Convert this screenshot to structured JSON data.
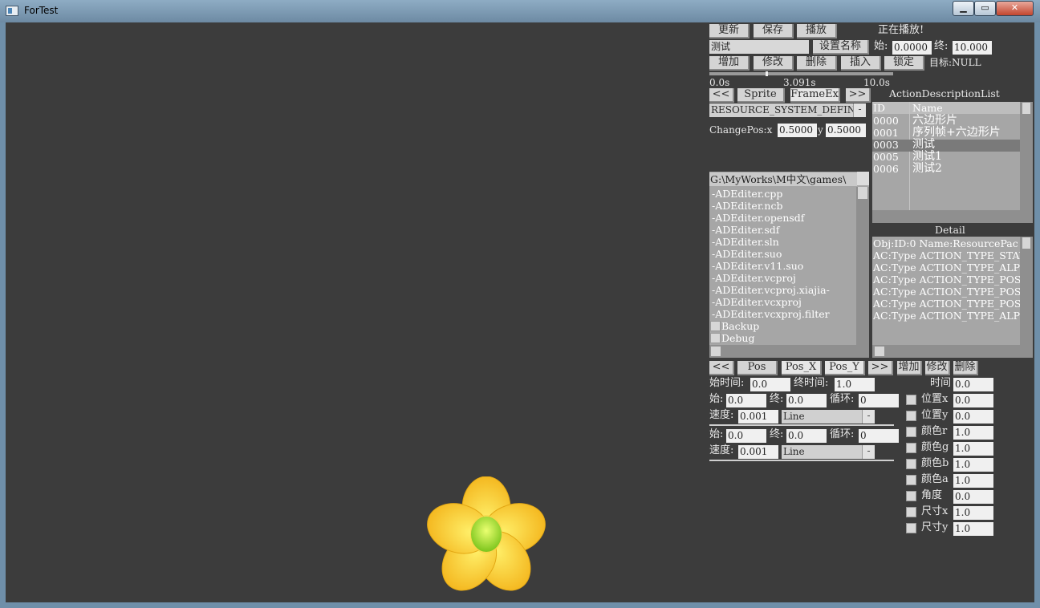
{
  "window": {
    "title": "ForTest",
    "min": "▁",
    "max": "▭",
    "close": "✕"
  },
  "toolbar": {
    "update": "更新",
    "save": "保存",
    "play": "播放",
    "status": "正在播放!",
    "name_value": "测试",
    "set_name": "设置名称",
    "start_label": "始:",
    "start_value": "0.0000",
    "end_label": "终:",
    "end_value": "10.000",
    "add": "增加",
    "modify": "修改",
    "delete": "删除",
    "insert": "插入",
    "lock": "锁定",
    "target": "目标:NULL"
  },
  "timeline": {
    "start": "0.0s",
    "current": "3.091s",
    "end": "10.0s",
    "progress": 0.309
  },
  "tabs": {
    "prev": "<<",
    "sprite": "Sprite",
    "frameex": "FrameEx",
    "next": ">>"
  },
  "resource": {
    "selected": "RESOURCE_SYSTEM_DEFINE",
    "arrow": "-"
  },
  "change_pos": {
    "label_x": "ChangePos:x",
    "x_value": "0.5000",
    "label_y": "y",
    "y_value": "0.5000"
  },
  "action_list": {
    "title": "ActionDescriptionList",
    "col_id": "ID",
    "col_name": "Name",
    "rows": [
      {
        "id": "0000",
        "name": "六边形片"
      },
      {
        "id": "0001",
        "name": "序列帧+六边形片"
      },
      {
        "id": "0003",
        "name": "测试"
      },
      {
        "id": "0005",
        "name": "测试1"
      },
      {
        "id": "0006",
        "name": "测试2"
      }
    ],
    "selected_index": 2
  },
  "file_browser": {
    "path": "G:\\MyWorks\\M中文\\games\\",
    "files": [
      "-ADEditer.cpp",
      "-ADEditer.ncb",
      "-ADEditer.opensdf",
      "-ADEditer.sdf",
      "-ADEditer.sln",
      "-ADEditer.suo",
      "-ADEditer.v11.suo",
      "-ADEditer.vcproj",
      "-ADEditer.vcproj.xiajia-",
      "-ADEditer.vcxproj",
      "-ADEditer.vcxproj.filter"
    ],
    "folders": [
      "Backup",
      "Debug"
    ]
  },
  "detail": {
    "title": "Detail",
    "lines": [
      "Obj:ID:0 Name:ResourcePac",
      "AC:Type ACTION_TYPE_STAY,",
      "AC:Type ACTION_TYPE_ALPHA",
      "AC:Type ACTION_TYPE_POSIT",
      "AC:Type ACTION_TYPE_POSIT",
      "AC:Type ACTION_TYPE_POSIT",
      "AC:Type ACTION_TYPE_ALPHA"
    ]
  },
  "motion_tabs": {
    "prev": "<<",
    "pos": "Pos",
    "pos_x": "Pos_X",
    "pos_y": "Pos_Y",
    "next": ">>",
    "add": "增加",
    "modify": "修改",
    "delete": "删除"
  },
  "motion": {
    "start_time_label": "始时间:",
    "start_time": "0.0",
    "end_time_label": "终时间:",
    "end_time": "1.0",
    "group1": {
      "start_label": "始:",
      "start": "0.0",
      "end_label": "终:",
      "end": "0.0",
      "loop_label": "循环:",
      "loop": "0",
      "speed_label": "速度:",
      "speed": "0.001",
      "curve": "Line",
      "arrow": "-"
    },
    "group2": {
      "start_label": "始:",
      "start": "0.0",
      "end_label": "终:",
      "end": "0.0",
      "loop_label": "循环:",
      "loop": "0",
      "speed_label": "速度:",
      "speed": "0.001",
      "curve": "Line",
      "arrow": "-"
    }
  },
  "props": {
    "time_label": "时间",
    "time": "0.0",
    "items": [
      {
        "label": "位置x",
        "value": "0.0"
      },
      {
        "label": "位置y",
        "value": "0.0"
      },
      {
        "label": "颜色r",
        "value": "1.0"
      },
      {
        "label": "颜色g",
        "value": "1.0"
      },
      {
        "label": "颜色b",
        "value": "1.0"
      },
      {
        "label": "颜色a",
        "value": "1.0"
      },
      {
        "label": "角度",
        "value": "0.0"
      },
      {
        "label": "尺寸x",
        "value": "1.0"
      },
      {
        "label": "尺寸y",
        "value": "1.0"
      }
    ]
  },
  "colors": {
    "canvas": "#3c3c3c",
    "petal": "#ffd23a",
    "center": "#a8dc28"
  }
}
